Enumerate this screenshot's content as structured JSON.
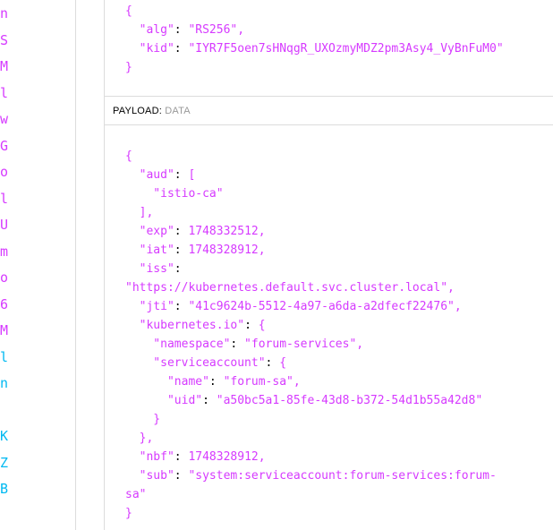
{
  "encoded_column": [
    {
      "ch": "n",
      "color": "#d63aff"
    },
    {
      "ch": "S",
      "color": "#d63aff"
    },
    {
      "ch": "M",
      "color": "#d63aff"
    },
    {
      "ch": "l",
      "color": "#d63aff"
    },
    {
      "ch": "w",
      "color": "#d63aff"
    },
    {
      "ch": "G",
      "color": "#d63aff"
    },
    {
      "ch": "o",
      "color": "#d63aff"
    },
    {
      "ch": "l",
      "color": "#d63aff"
    },
    {
      "ch": "U",
      "color": "#d63aff"
    },
    {
      "ch": "m",
      "color": "#d63aff"
    },
    {
      "ch": "o",
      "color": "#d63aff"
    },
    {
      "ch": "6",
      "color": "#d63aff"
    },
    {
      "ch": "M",
      "color": "#d63aff"
    },
    {
      "ch": "l",
      "color": "#00b9f1"
    },
    {
      "ch": "n",
      "color": "#00b9f1"
    },
    {
      "ch": "",
      "color": "#00b9f1"
    },
    {
      "ch": "K",
      "color": "#00b9f1"
    },
    {
      "ch": "Z",
      "color": "#00b9f1"
    },
    {
      "ch": "B",
      "color": "#00b9f1"
    }
  ],
  "header": {
    "lines": [
      {
        "t": "{",
        "cls": "p"
      },
      {
        "key": "\"alg\"",
        "val": "\"RS256\","
      },
      {
        "key": "\"kid\"",
        "val": "\"IYR7F5oen7sHNqgR_UXOzmyMDZ2pm3Asy4_VyBnFuM0\""
      },
      {
        "t": "}",
        "cls": "p"
      }
    ]
  },
  "payload_section": {
    "label": "PAYLOAD:",
    "sublabel": "DATA"
  },
  "payload": {
    "lines": [
      {
        "t": "{"
      },
      {
        "t": "  \"aud\": ["
      },
      {
        "t": "    \"istio-ca\""
      },
      {
        "t": "  ],"
      },
      {
        "t": "  \"exp\": 1748332512,"
      },
      {
        "t": "  \"iat\": 1748328912,"
      },
      {
        "t": "  \"iss\":"
      },
      {
        "t": "\"https://kubernetes.default.svc.cluster.local\","
      },
      {
        "t": "  \"jti\": \"41c9624b-5512-4a97-a6da-a2dfecf22476\","
      },
      {
        "t": "  \"kubernetes.io\": {"
      },
      {
        "t": "    \"namespace\": \"forum-services\","
      },
      {
        "t": "    \"serviceaccount\": {"
      },
      {
        "t": "      \"name\": \"forum-sa\","
      },
      {
        "t": "      \"uid\": \"a50bc5a1-85fe-43d8-b372-54d1b55a42d8\""
      },
      {
        "t": "    }"
      },
      {
        "t": "  },"
      },
      {
        "t": "  \"nbf\": 1748328912,"
      },
      {
        "t": "  \"sub\": \"system:serviceaccount:forum-services:forum-"
      },
      {
        "t": "sa\""
      },
      {
        "t": "}"
      }
    ]
  }
}
